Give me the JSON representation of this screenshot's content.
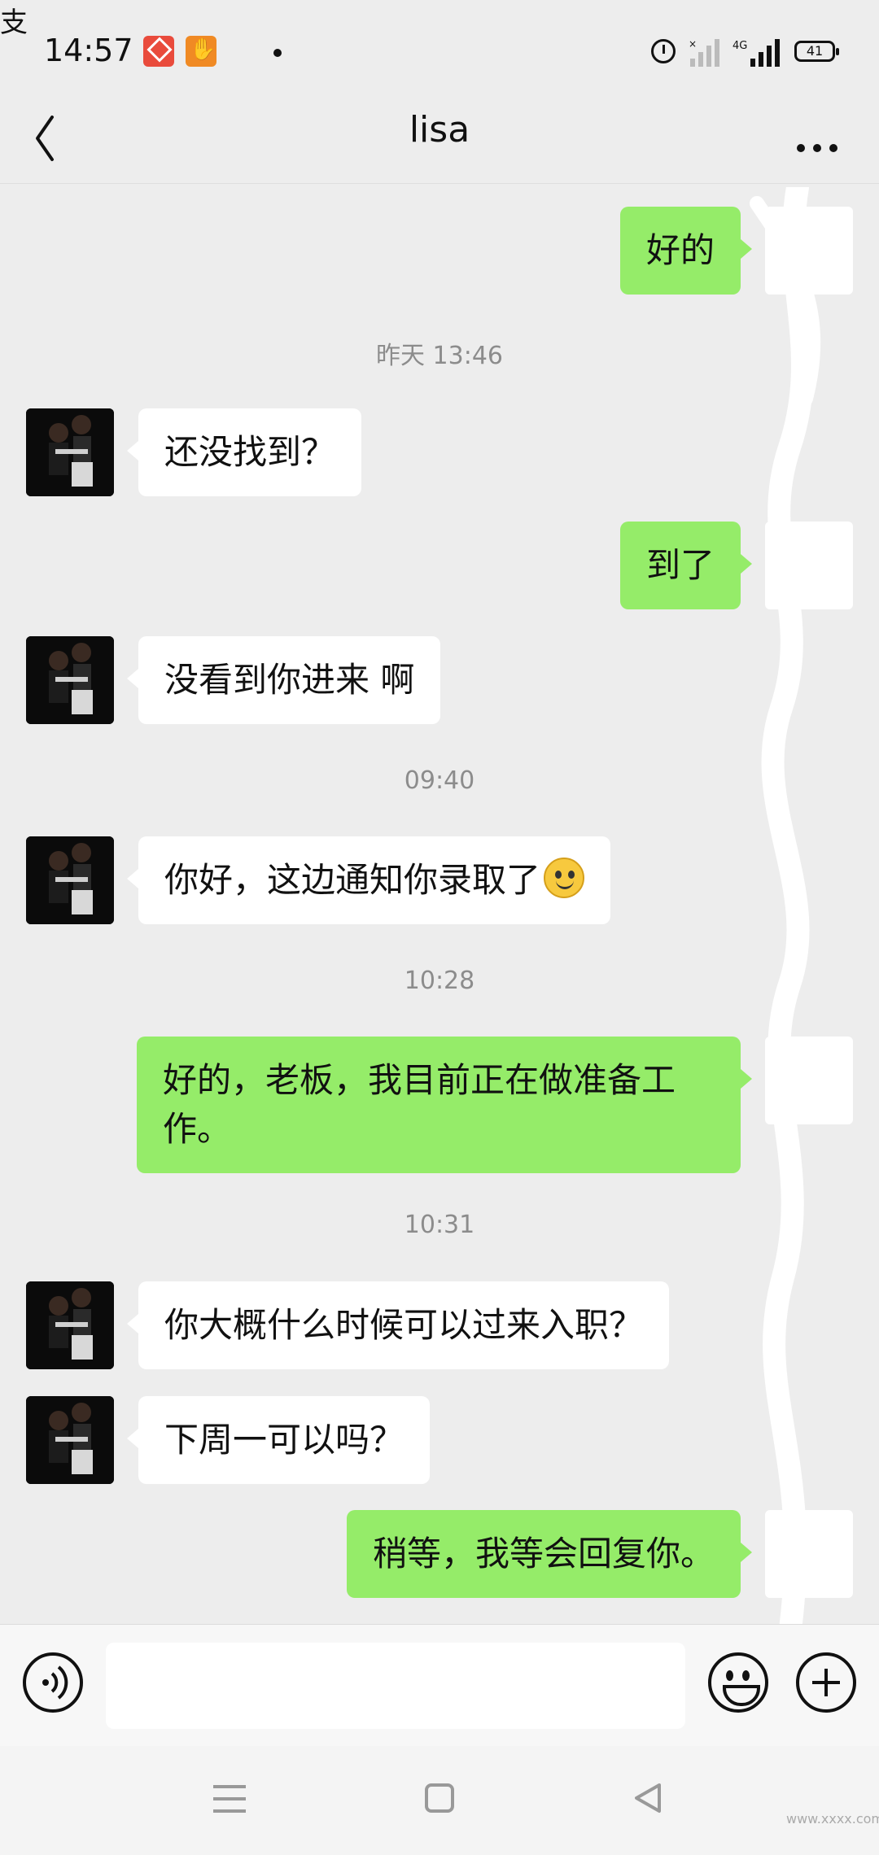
{
  "status_bar": {
    "time": "14:57",
    "battery": "41",
    "network": "4G",
    "icons": [
      "app-icon-1",
      "hand-icon",
      "alipay-icon",
      "alarm-icon",
      "signal-icon",
      "signal-4g-icon",
      "battery-icon"
    ]
  },
  "header": {
    "title": "lisa",
    "back_icon": "chevron-left-icon",
    "more_icon": "more-dots-icon"
  },
  "messages": [
    {
      "side": "out",
      "text": "好的"
    },
    {
      "type": "time",
      "text": "昨天 13:46"
    },
    {
      "side": "in",
      "text": "还没找到？"
    },
    {
      "side": "out",
      "text": "到了"
    },
    {
      "side": "in",
      "text": "没看到你进来 啊"
    },
    {
      "type": "time",
      "text": "09:40"
    },
    {
      "side": "in",
      "text": "你好，这边通知你录取了",
      "emoji": "smile"
    },
    {
      "type": "time",
      "text": "10:28"
    },
    {
      "side": "out",
      "text": "好的，老板，我目前正在做准备工作。"
    },
    {
      "type": "time",
      "text": "10:31"
    },
    {
      "side": "in",
      "text": "你大概什么时候可以过来入职？"
    },
    {
      "side": "in",
      "text": "下周一可以吗？"
    },
    {
      "side": "out",
      "text": "稍等，我等会回复你。"
    }
  ],
  "input_bar": {
    "value": "",
    "icons": [
      "voice-icon",
      "emoji-icon",
      "plus-icon"
    ]
  },
  "nav_bar": {
    "icons": [
      "menu-icon",
      "home-icon",
      "back-triangle-icon"
    ],
    "watermark": "www.xxxx.com"
  },
  "colors": {
    "background": "#ededed",
    "outgoing_bubble": "#95ec69",
    "incoming_bubble": "#ffffff",
    "timestamp": "#8c8c8c"
  }
}
